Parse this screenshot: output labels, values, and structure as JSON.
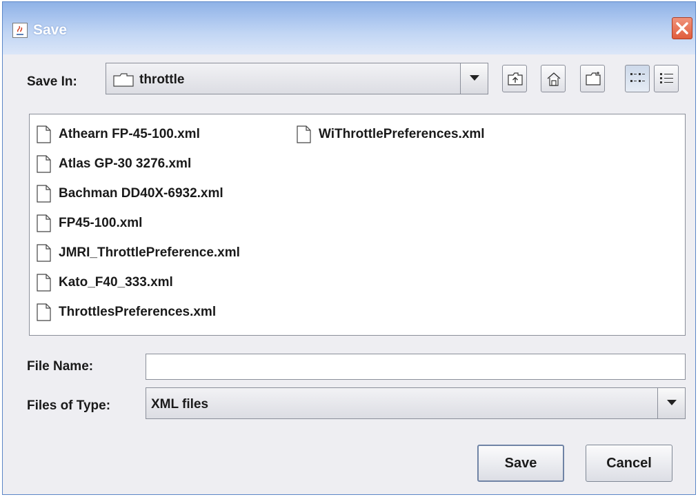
{
  "window": {
    "title": "Save"
  },
  "toolbar": {
    "save_in_label": "Save In:",
    "current_folder": "throttle",
    "buttons": [
      "up-one-level",
      "home",
      "new-folder",
      "list-view",
      "details-view"
    ]
  },
  "files": [
    "Athearn FP-45-100.xml",
    "Atlas GP-30 3276.xml",
    "Bachman DD40X-6932.xml",
    "FP45-100.xml",
    "JMRI_ThrottlePreference.xml",
    "Kato_F40_333.xml",
    "ThrottlesPreferences.xml",
    "WiThrottlePreferences.xml"
  ],
  "form": {
    "file_name_label": "File Name:",
    "file_name_value": "",
    "files_of_type_label": "Files of Type:",
    "files_of_type_value": "XML files"
  },
  "buttons": {
    "save": "Save",
    "cancel": "Cancel"
  },
  "colors": {
    "titlebar": "#a7c3ee",
    "close": "#e05d3d",
    "dialog_bg": "#eeeef2"
  }
}
